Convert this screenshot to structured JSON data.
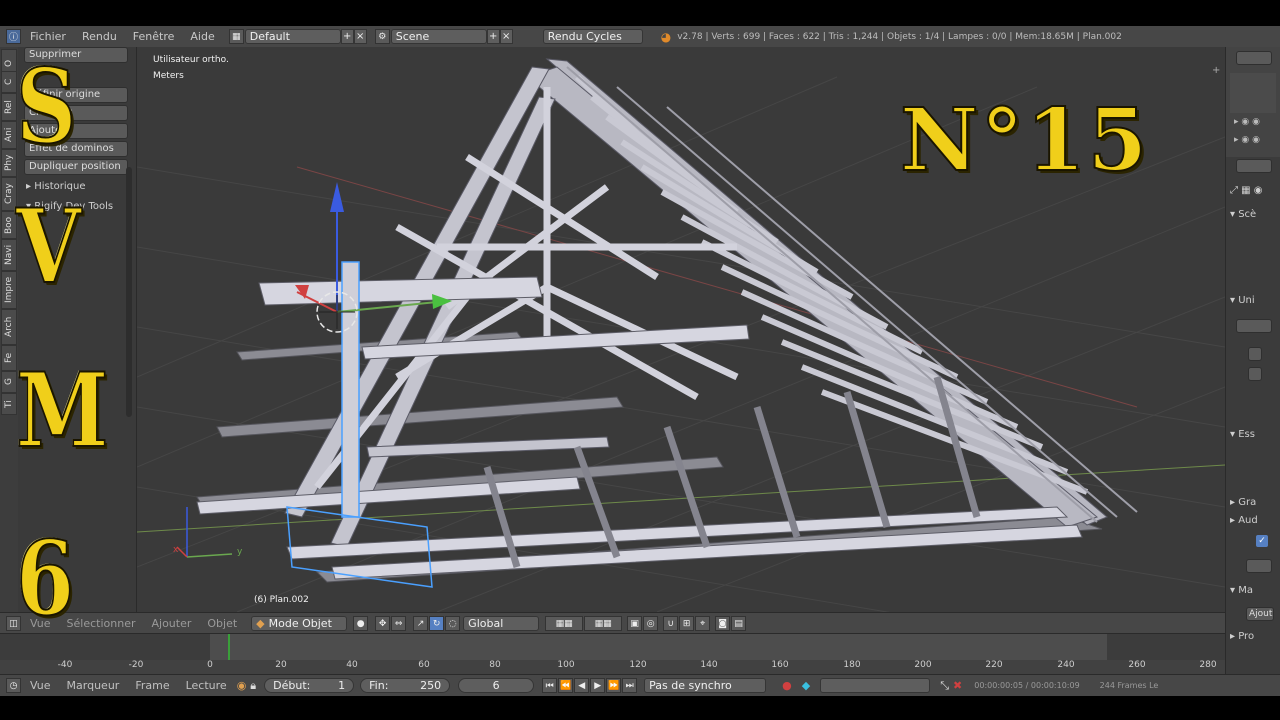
{
  "info_header": {
    "menus": [
      "Fichier",
      "Rendu",
      "Fenêtre",
      "Aide"
    ],
    "layout": "Default",
    "scene": "Scene",
    "render_engine": "Rendu Cycles",
    "stats": "v2.78 | Verts : 699 | Faces : 622 | Tris : 1,244 | Objets : 1/4 | Lampes : 0/0 | Mem:18.65M | Plan.002"
  },
  "left_tabs": [
    "O",
    "C",
    "Rel",
    "Ani",
    "Phy",
    "Cray",
    "Boo",
    "Navi",
    "Impre",
    "Arch",
    "Fe",
    "G",
    "Ti"
  ],
  "tool_shelf": {
    "buttons": [
      "Supprimer",
      "Définir origine",
      "Chemins",
      "Ajouter",
      "Effet de dominos",
      "Dupliquer position"
    ],
    "sections": [
      "Historique",
      "Rigify Dev Tools"
    ]
  },
  "viewport": {
    "view_label": "Utilisateur ortho.",
    "units_label": "Meters",
    "object_label": "(6) Plan.002",
    "axis_x": "x",
    "axis_y": "y"
  },
  "overlay": {
    "letters": [
      "S",
      "V",
      "M",
      "6"
    ],
    "episode": "N°15"
  },
  "vp_header": {
    "menus": [
      "Vue",
      "Sélectionner",
      "Ajouter",
      "Objet"
    ],
    "mode": "Mode Objet",
    "orientation": "Global"
  },
  "timeline": {
    "ticks": [
      "-40",
      "-20",
      "0",
      "20",
      "40",
      "60",
      "80",
      "100",
      "120",
      "140",
      "160",
      "180",
      "200",
      "220",
      "240",
      "260",
      "280"
    ]
  },
  "tl_header": {
    "menus": [
      "Vue",
      "Marqueur",
      "Frame",
      "Lecture"
    ],
    "start_label": "Début:",
    "start_value": "1",
    "end_label": "Fin:",
    "end_value": "250",
    "current_frame": "6",
    "sync": "Pas de synchro",
    "time": "00:00:00:05 / 00:00:10:09",
    "frames": "244 Frames Le"
  },
  "right_panel": {
    "sections": [
      "Scè",
      "Uni",
      "Ess",
      "Gra",
      "Aud",
      "Ma",
      "Pro"
    ],
    "button": "Ajout"
  },
  "colors": {
    "accent": "#5680c2",
    "overlay_yellow": "#f0cf1a",
    "x_axis": "#d04040",
    "y_axis": "#6aa84f",
    "z_axis": "#3a5be0"
  }
}
